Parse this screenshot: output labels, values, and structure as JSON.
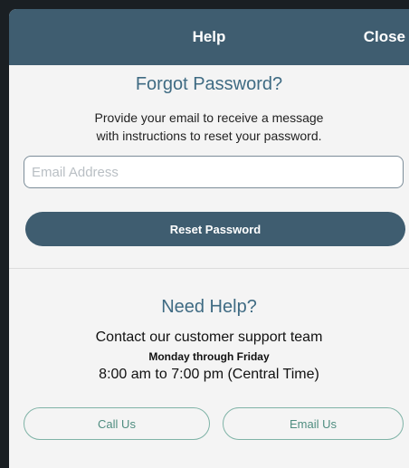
{
  "header": {
    "title": "Help",
    "close_label": "Close"
  },
  "forgot": {
    "title": "Forgot Password?",
    "line1": "Provide your email to receive a message",
    "line2": "with instructions to reset your password.",
    "email_placeholder": "Email Address",
    "email_value": "",
    "reset_label": "Reset Password"
  },
  "help": {
    "title": "Need Help?",
    "line1": "Contact our customer support team",
    "line2": "Monday through Friday",
    "line3": "8:00 am to 7:00 pm (Central Time)",
    "call_label": "Call Us",
    "email_label": "Email Us"
  },
  "colors": {
    "header_bg": "#3f5d70",
    "accent_text": "#3f6b83",
    "pill_border": "#7fb3a7",
    "pill_text": "#4f8d80"
  }
}
